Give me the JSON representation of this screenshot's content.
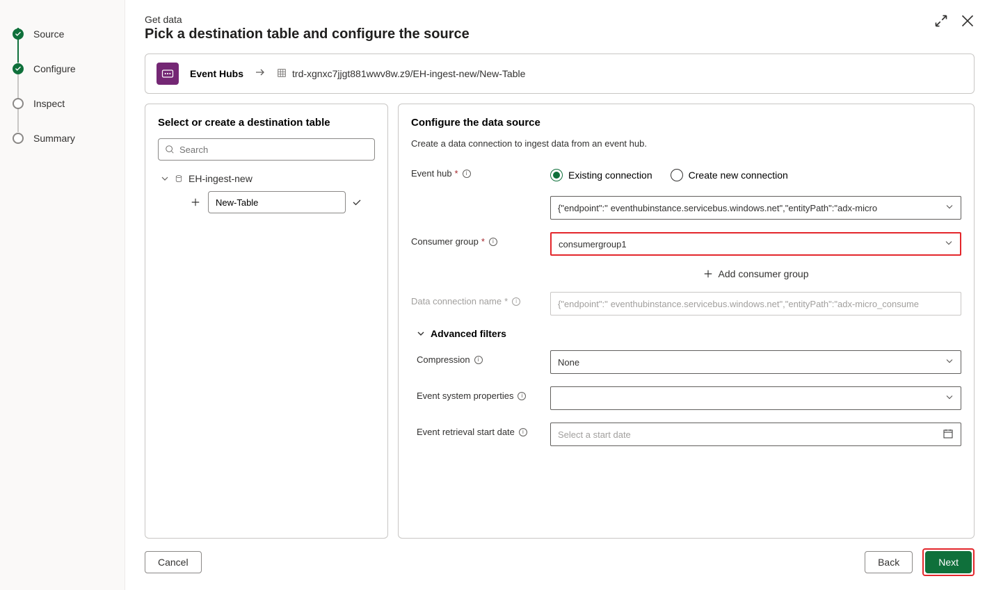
{
  "stepper": {
    "source": "Source",
    "configure": "Configure",
    "inspect": "Inspect",
    "summary": "Summary"
  },
  "header": {
    "pretitle": "Get data",
    "title": "Pick a destination table and configure the source"
  },
  "breadcrumb": {
    "source_label": "Event Hubs",
    "path": "trd-xgnxc7jjgt881wwv8w.z9/EH-ingest-new/New-Table"
  },
  "left_panel": {
    "title": "Select or create a destination table",
    "search_placeholder": "Search",
    "db_name": "EH-ingest-new",
    "new_table": "New-Table"
  },
  "right_panel": {
    "title": "Configure the data source",
    "subtitle": "Create a data connection to ingest data from an event hub.",
    "event_hub_label": "Event hub",
    "existing_connection": "Existing connection",
    "create_new_connection": "Create new connection",
    "connection_prefix": "{\"endpoint\":\"",
    "connection_rest": "eventhubinstance.servicebus.windows.net\",\"entityPath\":\"adx-micro",
    "consumer_group_label": "Consumer group",
    "consumer_group_value": "consumergroup1",
    "add_consumer_group": "Add consumer group",
    "data_conn_label": "Data connection name",
    "data_conn_prefix": "{\"endpoint\":\"",
    "data_conn_rest": "eventhubinstance.servicebus.windows.net\",\"entityPath\":\"adx-micro_consume",
    "advanced_filters": "Advanced filters",
    "compression_label": "Compression",
    "compression_value": "None",
    "event_sys_label": "Event system properties",
    "event_sys_value": "",
    "start_date_label": "Event retrieval start date",
    "start_date_placeholder": "Select a start date"
  },
  "footer": {
    "cancel": "Cancel",
    "back": "Back",
    "next": "Next"
  }
}
